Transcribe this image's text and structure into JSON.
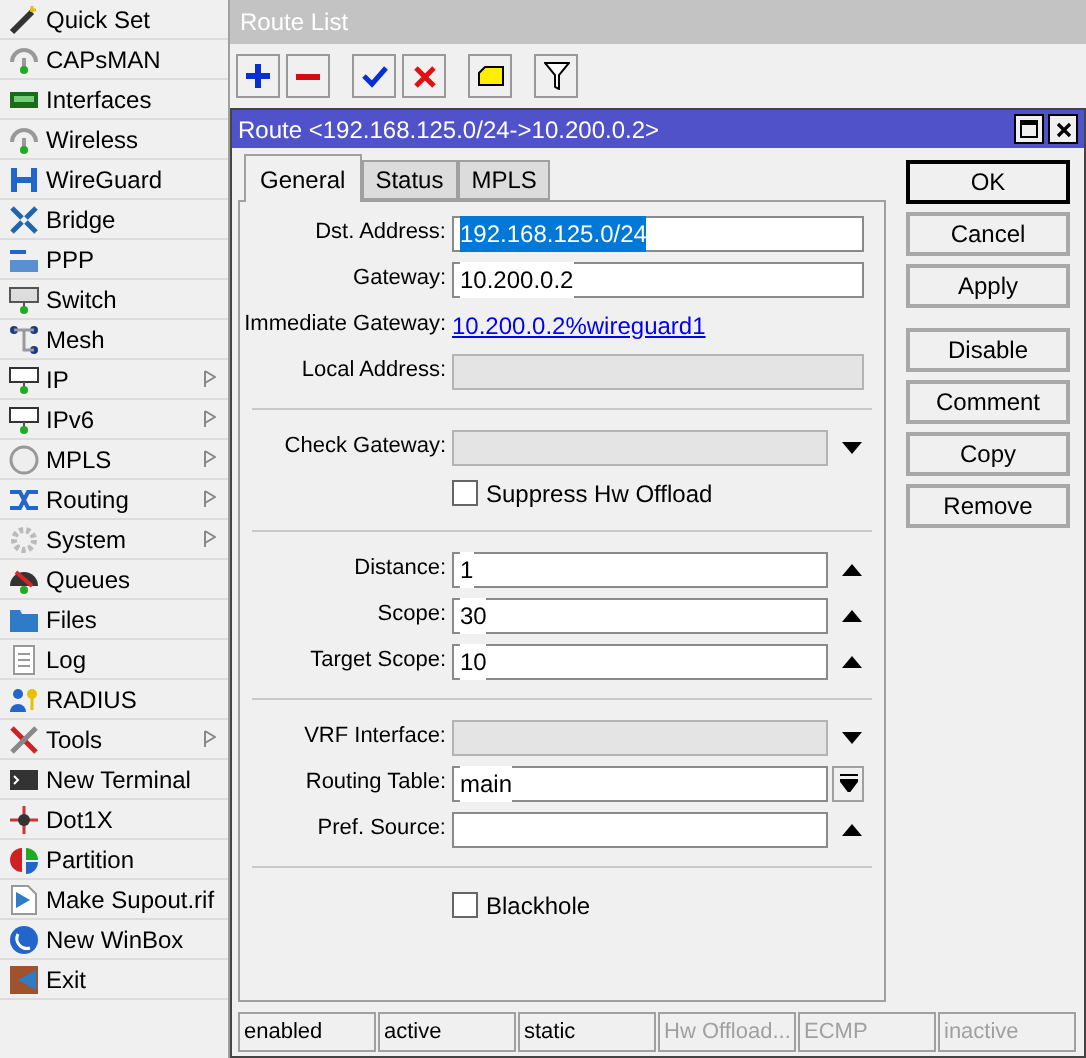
{
  "sidebar": {
    "items": [
      {
        "label": "Quick Set",
        "has_submenu": false
      },
      {
        "label": "CAPsMAN",
        "has_submenu": false
      },
      {
        "label": "Interfaces",
        "has_submenu": false
      },
      {
        "label": "Wireless",
        "has_submenu": false
      },
      {
        "label": "WireGuard",
        "has_submenu": false
      },
      {
        "label": "Bridge",
        "has_submenu": false
      },
      {
        "label": "PPP",
        "has_submenu": false
      },
      {
        "label": "Switch",
        "has_submenu": false
      },
      {
        "label": "Mesh",
        "has_submenu": false
      },
      {
        "label": "IP",
        "has_submenu": true
      },
      {
        "label": "IPv6",
        "has_submenu": true
      },
      {
        "label": "MPLS",
        "has_submenu": true
      },
      {
        "label": "Routing",
        "has_submenu": true
      },
      {
        "label": "System",
        "has_submenu": true
      },
      {
        "label": "Queues",
        "has_submenu": false
      },
      {
        "label": "Files",
        "has_submenu": false
      },
      {
        "label": "Log",
        "has_submenu": false
      },
      {
        "label": "RADIUS",
        "has_submenu": false
      },
      {
        "label": "Tools",
        "has_submenu": true
      },
      {
        "label": "New Terminal",
        "has_submenu": false
      },
      {
        "label": "Dot1X",
        "has_submenu": false
      },
      {
        "label": "Partition",
        "has_submenu": false
      },
      {
        "label": "Make Supout.rif",
        "has_submenu": false
      },
      {
        "label": "New WinBox",
        "has_submenu": false
      },
      {
        "label": "Exit",
        "has_submenu": false
      }
    ]
  },
  "route_list": {
    "title": "Route List"
  },
  "dialog": {
    "title": "Route <192.168.125.0/24->10.200.0.2>",
    "tabs": [
      {
        "label": "General",
        "selected": true
      },
      {
        "label": "Status",
        "selected": false
      },
      {
        "label": "MPLS",
        "selected": false
      }
    ],
    "sections": [
      [
        {
          "kind": "input",
          "label": "Dst. Address:",
          "value": "192.168.125.0/24",
          "highlighted": true,
          "disabled": false
        },
        {
          "kind": "input",
          "label": "Gateway:",
          "value": "10.200.0.2",
          "highlighted": false,
          "disabled": false
        },
        {
          "kind": "link",
          "label": "Immediate Gateway:",
          "value": "10.200.0.2%wireguard1"
        },
        {
          "kind": "input",
          "label": "Local Address:",
          "disabled": true
        }
      ],
      [
        {
          "kind": "combo",
          "label": "Check Gateway:",
          "disabled": true
        },
        {
          "kind": "checkbox",
          "label": "Suppress Hw Offload",
          "checked": false
        }
      ],
      [
        {
          "kind": "spinner",
          "label": "Distance:",
          "value": "1",
          "highlighted": false,
          "disabled": false
        },
        {
          "kind": "spinner",
          "label": "Scope:",
          "value": "30",
          "highlighted": false,
          "disabled": false
        },
        {
          "kind": "spinner",
          "label": "Target Scope:",
          "value": "10",
          "highlighted": false,
          "disabled": false
        }
      ],
      [
        {
          "kind": "combo",
          "label": "VRF Interface:",
          "disabled": true
        },
        {
          "kind": "select",
          "label": "Routing Table:",
          "value": "main",
          "highlighted": false,
          "disabled": false
        },
        {
          "kind": "spinner",
          "label": "Pref. Source:",
          "disabled": false
        }
      ],
      [
        {
          "kind": "checkbox",
          "label": "Blackhole",
          "checked": false
        }
      ]
    ],
    "button_groups": [
      [
        {
          "label": "OK",
          "default": true
        },
        {
          "label": "Cancel",
          "default": false
        },
        {
          "label": "Apply",
          "default": false
        }
      ],
      [
        {
          "label": "Disable",
          "default": false
        },
        {
          "label": "Comment",
          "default": false
        },
        {
          "label": "Copy",
          "default": false
        },
        {
          "label": "Remove",
          "default": false
        }
      ]
    ],
    "status_bar": [
      {
        "text": "enabled",
        "disabled": false
      },
      {
        "text": "active",
        "disabled": false
      },
      {
        "text": "static",
        "disabled": false
      },
      {
        "text": "Hw Offload...",
        "disabled": true
      },
      {
        "text": "ECMP",
        "disabled": true
      },
      {
        "text": "inactive",
        "disabled": true
      }
    ]
  }
}
